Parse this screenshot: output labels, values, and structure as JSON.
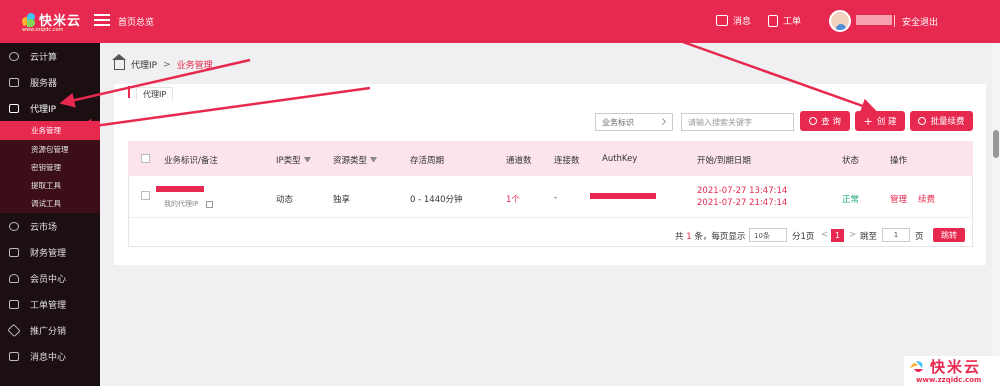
{
  "topbar": {
    "logo_text": "快米云",
    "logo_sub": "www.zzqidc.com",
    "home_label": "首页总览",
    "messages_label": "消息",
    "tickets_label": "工单",
    "logout_label": "安全退出"
  },
  "sidebar": {
    "items": [
      {
        "label": "云计算"
      },
      {
        "label": "服务器"
      },
      {
        "label": "代理IP"
      },
      {
        "label": "云市场"
      },
      {
        "label": "财务管理"
      },
      {
        "label": "会员中心"
      },
      {
        "label": "工单管理"
      },
      {
        "label": "推广分销"
      },
      {
        "label": "消息中心"
      }
    ],
    "sub_items": [
      {
        "label": "业务管理"
      },
      {
        "label": "资源包管理"
      },
      {
        "label": "密钥管理"
      },
      {
        "label": "提取工具"
      },
      {
        "label": "调试工具"
      }
    ]
  },
  "breadcrumb": {
    "parent": "代理IP",
    "sep": ">",
    "current": "业务管理"
  },
  "tab": {
    "label": "代理IP"
  },
  "toolbar": {
    "select_value": "业务标识",
    "search_placeholder": "请输入搜索关键字",
    "query_label": "查 询",
    "create_label": "创 建",
    "renew_label": "批量续费"
  },
  "table": {
    "headers": [
      "业务标识/备注",
      "IP类型",
      "资源类型",
      "存活周期",
      "通道数",
      "连接数",
      "AuthKey",
      "开始/到期日期",
      "状态",
      "操作"
    ],
    "rows": [
      {
        "remark": "我的代理IP",
        "ip_type": "动态",
        "resource_type": "独享",
        "lifetime": "0 - 1440分钟",
        "channels": "1个",
        "connections": "-",
        "start": "2021-07-27 13:47:14",
        "end": "2021-07-27 21:47:14",
        "status": "正常",
        "action_manage": "管理",
        "action_renew": "续费"
      }
    ]
  },
  "pager": {
    "total_prefix": "共",
    "total": "1",
    "total_suffix": "条，每页显示",
    "page_size": "10条",
    "pages": "分1页",
    "current": "1",
    "jump_label": "跳至",
    "jump_value": "1",
    "page_unit": "页",
    "go_label": "跳转"
  },
  "watermark": {
    "text": "快米云",
    "url": "www.zzqidc.com"
  },
  "colors": {
    "brand": "#e8294f",
    "sidebar": "#1b0f12",
    "status_ok": "#1aaa82"
  }
}
